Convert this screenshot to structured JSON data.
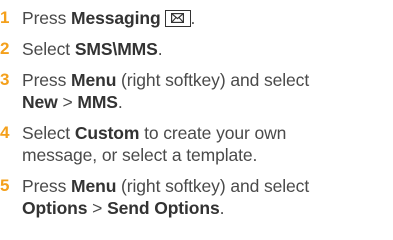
{
  "steps": [
    {
      "num": "1",
      "pre": "Press ",
      "bold1": "Messaging",
      "icon": "envelope-icon",
      "post": "."
    },
    {
      "num": "2",
      "pre": "Select ",
      "bold1": "SMS\\MMS",
      "post": "."
    },
    {
      "num": "3",
      "pre": "Press ",
      "bold1": "Menu",
      "mid1": " (right softkey) and select",
      "bold2": "New",
      "mid2": " > ",
      "bold3": "MMS",
      "post": "."
    },
    {
      "num": "4",
      "pre": "Select ",
      "bold1": "Custom",
      "mid1": " to create your own",
      "line2": "message, or select a template."
    },
    {
      "num": "5",
      "pre": "Press ",
      "bold1": "Menu",
      "mid1": " (right softkey) and select",
      "bold2": "Options",
      "mid2": " > ",
      "bold3": "Send Options",
      "post": "."
    }
  ]
}
